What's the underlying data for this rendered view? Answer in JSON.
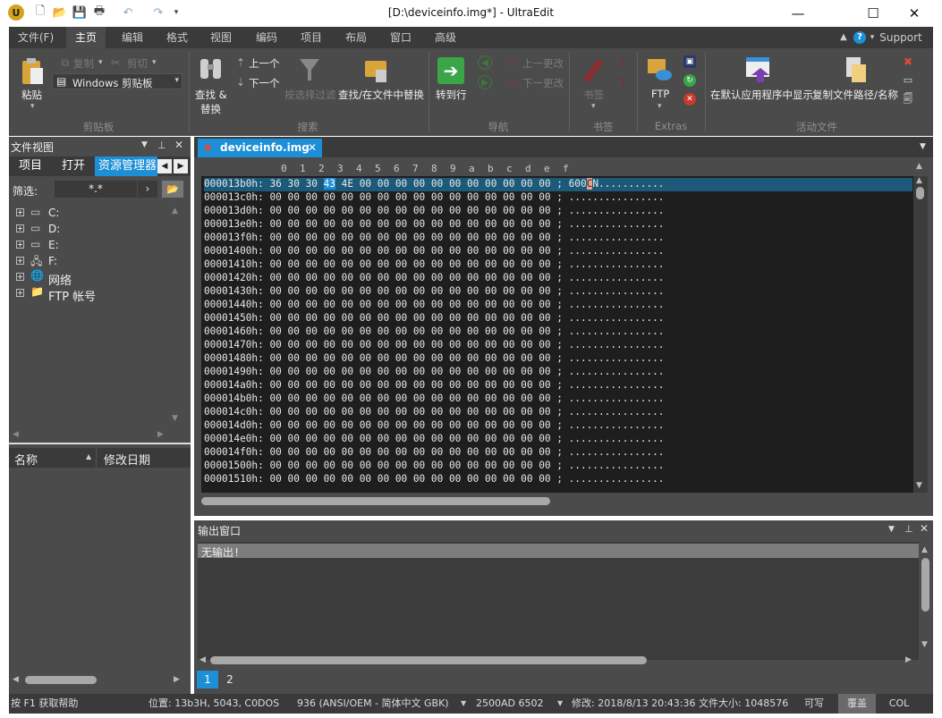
{
  "window": {
    "title": "[D:\\deviceinfo.img*] - UltraEdit",
    "minimize": "—",
    "maximize": "☐",
    "close": "✕"
  },
  "menu_tabs": [
    "文件(F)",
    "主页",
    "编辑",
    "格式",
    "视图",
    "编码",
    "项目",
    "布局",
    "窗口",
    "高级"
  ],
  "menu_right": {
    "help": "?",
    "support": "Support"
  },
  "ribbon": {
    "paste": "粘贴",
    "copy": "复制",
    "cut": "剪切",
    "clipboard_select": "Windows 剪贴板",
    "find_replace_1": "查找 &",
    "find_replace_2": "替换",
    "prev": "上一个",
    "next": "下一个",
    "filter": "按选择过滤",
    "find_in_files": "查找/在文件中替换",
    "goto": "转到行",
    "prev_change": "上一更改",
    "next_change": "下一更改",
    "bookmark": "书签",
    "ftp": "FTP",
    "open_default": "在默认应用程序中显示",
    "copy_path": "复制文件路径/名称",
    "groups": {
      "clipboard": "剪贴板",
      "search": "搜索",
      "nav": "导航",
      "bookmarks": "书签",
      "extras": "Extras",
      "active": "活动文件"
    }
  },
  "filetree": {
    "title": "文件视图",
    "tabs": [
      "项目",
      "打开",
      "资源管理器"
    ],
    "filter_label": "筛选:",
    "filter_value": "*.*",
    "items": [
      "C:",
      "D:",
      "E:",
      "F:",
      "网络",
      "FTP 帐号"
    ],
    "col_name": "名称",
    "col_date": "修改日期"
  },
  "editor": {
    "tab_label": "deviceinfo.img",
    "ruler": [
      "0",
      "1",
      "2",
      "3",
      "4",
      "5",
      "6",
      "7",
      "8",
      "9",
      "a",
      "b",
      "c",
      "d",
      "e",
      "f"
    ],
    "rows": [
      {
        "addr": "000013b0h:",
        "hex": "36 30 30 43 4E 00 00 00 00 00 00 00 00 00 00 00",
        "ascii": "600CN..........."
      },
      {
        "addr": "000013c0h:",
        "hex": "00 00 00 00 00 00 00 00 00 00 00 00 00 00 00 00",
        "ascii": "................"
      },
      {
        "addr": "000013d0h:",
        "hex": "00 00 00 00 00 00 00 00 00 00 00 00 00 00 00 00",
        "ascii": "................"
      },
      {
        "addr": "000013e0h:",
        "hex": "00 00 00 00 00 00 00 00 00 00 00 00 00 00 00 00",
        "ascii": "................"
      },
      {
        "addr": "000013f0h:",
        "hex": "00 00 00 00 00 00 00 00 00 00 00 00 00 00 00 00",
        "ascii": "................"
      },
      {
        "addr": "00001400h:",
        "hex": "00 00 00 00 00 00 00 00 00 00 00 00 00 00 00 00",
        "ascii": "................"
      },
      {
        "addr": "00001410h:",
        "hex": "00 00 00 00 00 00 00 00 00 00 00 00 00 00 00 00",
        "ascii": "................"
      },
      {
        "addr": "00001420h:",
        "hex": "00 00 00 00 00 00 00 00 00 00 00 00 00 00 00 00",
        "ascii": "................"
      },
      {
        "addr": "00001430h:",
        "hex": "00 00 00 00 00 00 00 00 00 00 00 00 00 00 00 00",
        "ascii": "................"
      },
      {
        "addr": "00001440h:",
        "hex": "00 00 00 00 00 00 00 00 00 00 00 00 00 00 00 00",
        "ascii": "................"
      },
      {
        "addr": "00001450h:",
        "hex": "00 00 00 00 00 00 00 00 00 00 00 00 00 00 00 00",
        "ascii": "................"
      },
      {
        "addr": "00001460h:",
        "hex": "00 00 00 00 00 00 00 00 00 00 00 00 00 00 00 00",
        "ascii": "................"
      },
      {
        "addr": "00001470h:",
        "hex": "00 00 00 00 00 00 00 00 00 00 00 00 00 00 00 00",
        "ascii": "................"
      },
      {
        "addr": "00001480h:",
        "hex": "00 00 00 00 00 00 00 00 00 00 00 00 00 00 00 00",
        "ascii": "................"
      },
      {
        "addr": "00001490h:",
        "hex": "00 00 00 00 00 00 00 00 00 00 00 00 00 00 00 00",
        "ascii": "................"
      },
      {
        "addr": "000014a0h:",
        "hex": "00 00 00 00 00 00 00 00 00 00 00 00 00 00 00 00",
        "ascii": "................"
      },
      {
        "addr": "000014b0h:",
        "hex": "00 00 00 00 00 00 00 00 00 00 00 00 00 00 00 00",
        "ascii": "................"
      },
      {
        "addr": "000014c0h:",
        "hex": "00 00 00 00 00 00 00 00 00 00 00 00 00 00 00 00",
        "ascii": "................"
      },
      {
        "addr": "000014d0h:",
        "hex": "00 00 00 00 00 00 00 00 00 00 00 00 00 00 00 00",
        "ascii": "................"
      },
      {
        "addr": "000014e0h:",
        "hex": "00 00 00 00 00 00 00 00 00 00 00 00 00 00 00 00",
        "ascii": "................"
      },
      {
        "addr": "000014f0h:",
        "hex": "00 00 00 00 00 00 00 00 00 00 00 00 00 00 00 00",
        "ascii": "................"
      },
      {
        "addr": "00001500h:",
        "hex": "00 00 00 00 00 00 00 00 00 00 00 00 00 00 00 00",
        "ascii": "................"
      },
      {
        "addr": "00001510h:",
        "hex": "00 00 00 00 00 00 00 00 00 00 00 00 00 00 00 00",
        "ascii": "................"
      }
    ],
    "sep": ";"
  },
  "output": {
    "title": "输出窗口",
    "text": "无输出!",
    "pages": [
      "1",
      "2"
    ]
  },
  "status": {
    "help": "按 F1 获取帮助",
    "position": "位置: 13b3H, 5043, C0",
    "format": "DOS",
    "codepage": "936  (ANSI/OEM - 简体中文 GBK)",
    "highlight": "2500AD 6502",
    "modified": "修改:   2018/8/13 20:43:36",
    "size": "文件大小:   1048576",
    "writable": "可写",
    "overwrite": "覆盖",
    "col": "COL"
  },
  "colors": {
    "accent": "#1c8fd6",
    "selection": "#1d5a7a",
    "panel": "#4b4b4b",
    "dark": "#3a3a3a"
  }
}
